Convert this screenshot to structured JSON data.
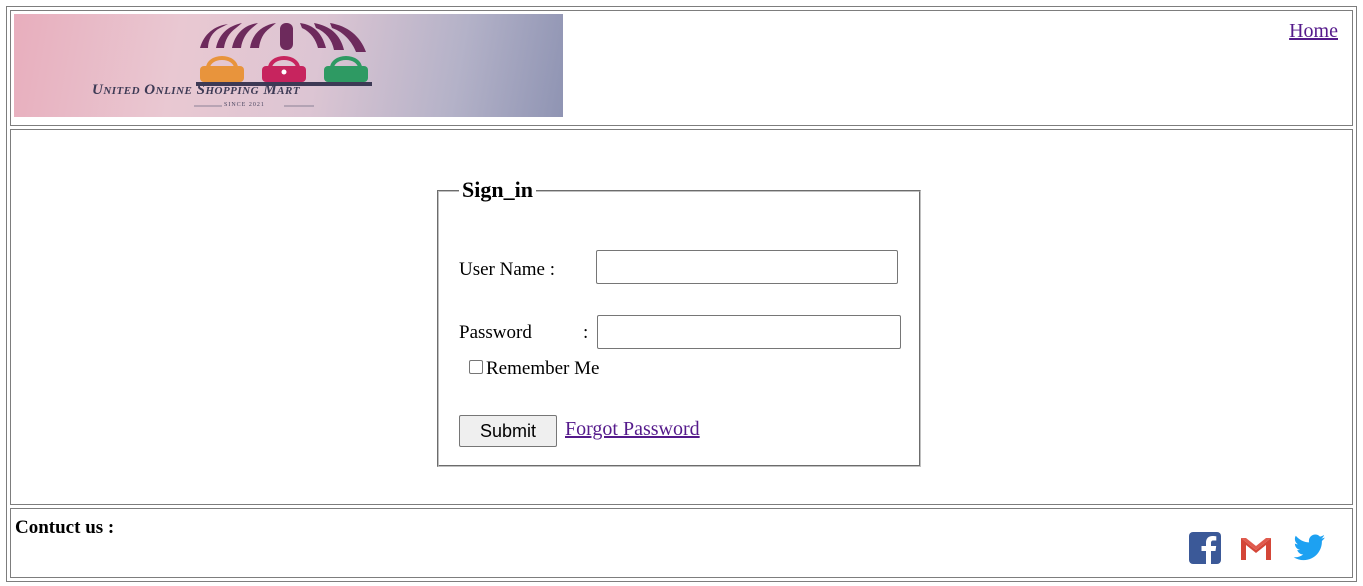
{
  "header": {
    "logo_text": "United Online Shopping Mart",
    "logo_since": "SINCE 2021",
    "home_link": "Home "
  },
  "signin": {
    "legend": "Sign_in",
    "username_label": "User Name :",
    "username_value": "",
    "password_label": "Password",
    "password_colon": ":",
    "password_value": "",
    "remember_label": "Remember Me",
    "remember_checked": false,
    "submit_label": "Submit",
    "forgot_link": "Forgot Password"
  },
  "footer": {
    "contact_label": "Contuct us :",
    "social_icons": [
      "facebook-icon",
      "gmail-icon",
      "twitter-icon"
    ]
  },
  "colors": {
    "border": "#7d7d7d",
    "visited_link": "#551a8b",
    "facebook": "#3b5998",
    "gmail": "#d44638",
    "twitter": "#1da1f2"
  }
}
